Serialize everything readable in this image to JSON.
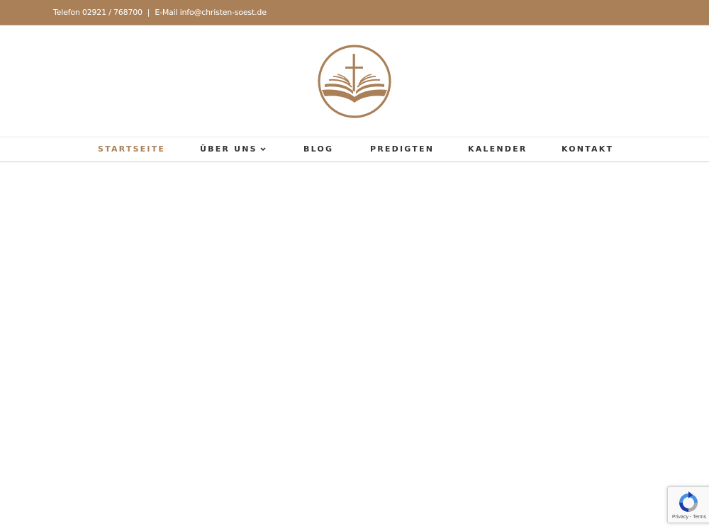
{
  "topbar": {
    "phone_text": "Telefon 02921 / 768700",
    "separator": "|",
    "email_text": "E-Mail info@christen-soest.de",
    "background_color": "#a98058"
  },
  "logo": {
    "icon": "cross-bible-logo-icon",
    "color": "#a98058"
  },
  "nav": {
    "active_color": "#a98058",
    "items": [
      {
        "label": "STARTSEITE",
        "active": true
      },
      {
        "label": "ÜBER UNS",
        "has_dropdown": true,
        "dropdown_icon": "chevron-down-icon"
      },
      {
        "label": "BLOG"
      },
      {
        "label": "PREDIGTEN"
      },
      {
        "label": "KALENDER"
      },
      {
        "label": "KONTAKT"
      }
    ]
  },
  "recaptcha": {
    "icon": "recaptcha-icon",
    "privacy_label": "Privacy",
    "separator": "-",
    "terms_label": "Terms"
  }
}
